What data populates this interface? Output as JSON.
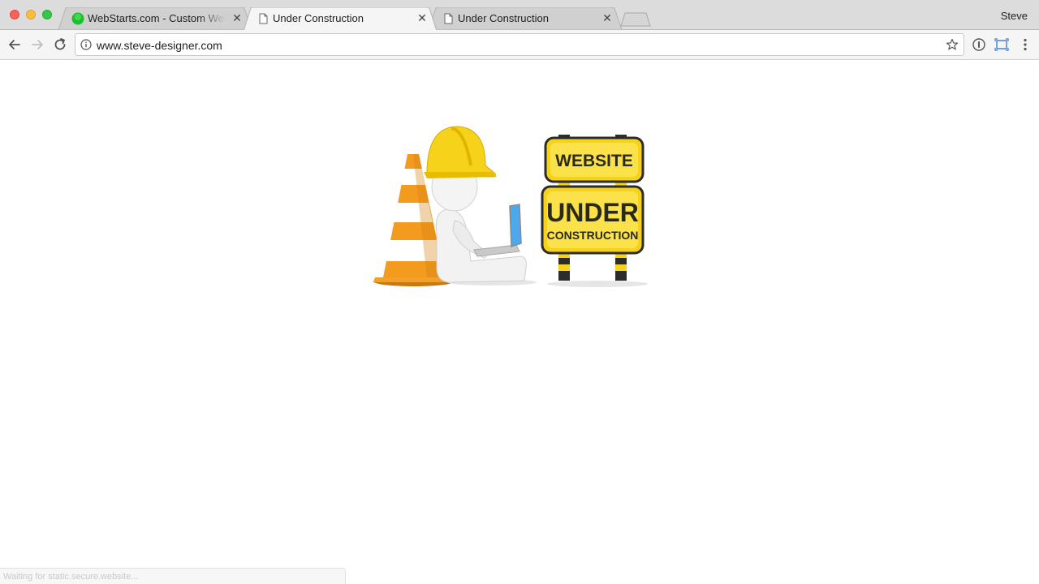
{
  "window": {
    "profile_name": "Steve"
  },
  "tabs": [
    {
      "title": "WebStarts.com - Custom Website",
      "favicon": "green-circle-favicon",
      "active": false
    },
    {
      "title": "Under Construction",
      "favicon": "page-icon",
      "active": true
    },
    {
      "title": "Under Construction",
      "favicon": "page-icon",
      "active": false
    }
  ],
  "toolbar": {
    "url": "www.steve-designer.com",
    "back_icon": "back-arrow-icon",
    "forward_icon": "forward-arrow-icon",
    "reload_icon": "reload-icon",
    "bookmark_icon": "star-icon",
    "menu_icon": "kebab-menu-icon"
  },
  "page": {
    "sign_line_1": "WEBSITE",
    "sign_line_2": "UNDER",
    "sign_line_3": "CONSTRUCTION"
  },
  "status": {
    "text": "Waiting for static.secure.website..."
  },
  "colors": {
    "accent_yellow": "#f7d21a",
    "cone_orange": "#f39b1f",
    "traffic_close": "#fc605c",
    "traffic_min": "#fdbc40",
    "traffic_max": "#34c84a"
  }
}
